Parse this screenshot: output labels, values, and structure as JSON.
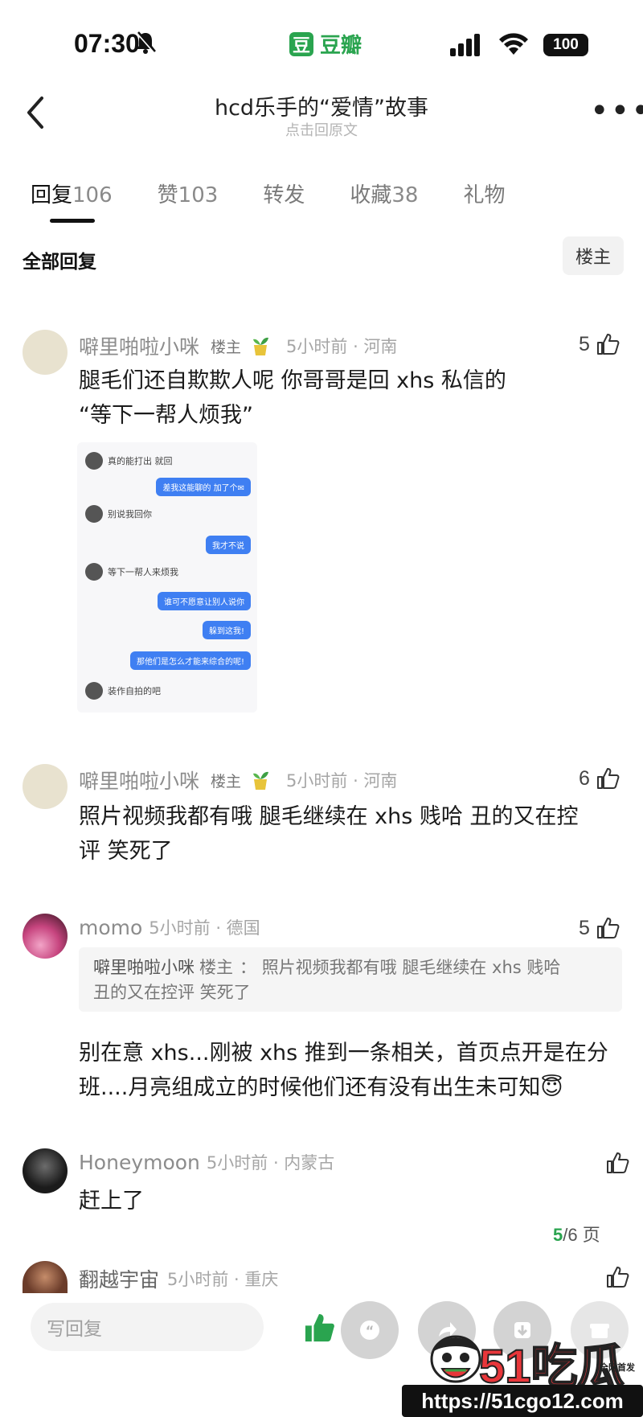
{
  "status_bar": {
    "time": "07:30",
    "app_name": "豆瓣",
    "app_logo_char": "豆",
    "battery": "100"
  },
  "header": {
    "title": "hcd乐手的“爱情”故事",
    "subtitle": "点击回原文"
  },
  "tabs": [
    {
      "label": "回复",
      "count": "106"
    },
    {
      "label": "赞",
      "count": "103"
    },
    {
      "label": "转发",
      "count": ""
    },
    {
      "label": "收藏",
      "count": "38"
    },
    {
      "label": "礼物",
      "count": ""
    }
  ],
  "section": {
    "all_replies": "全部回复",
    "op_filter": "楼主"
  },
  "comments": [
    {
      "name": "噼里啪啦小咪",
      "badge": "楼主",
      "meta": "5小时前 · 河南",
      "likes": "5",
      "lines": [
        "腿毛们还自欺欺人呢 你哥哥是回 xhs 私信的",
        "“等下一帮人烦我”"
      ],
      "image_chat": [
        "真的能打出 就回",
        "差我这能聊的 加了个✉",
        "别说我回你",
        "我才不说",
        "等下一帮人来烦我",
        "谁可不愿意让别人说你",
        "躲到这我!",
        "那他们是怎么才能来综合的呢!",
        "装作自拍的吧"
      ]
    },
    {
      "name": "噼里啪啦小咪",
      "badge": "楼主",
      "meta": "5小时前 · 河南",
      "likes": "6",
      "lines": [
        "照片视频我都有哦 腿毛继续在 xhs 贱哈  丑的又在控",
        "评 笑死了"
      ]
    },
    {
      "name": "momo",
      "badge": "",
      "meta": "5小时前 · 德国",
      "likes": "5",
      "quote": {
        "name": "噼里啪啦小咪",
        "badge": "楼主",
        "sep": "：",
        "text": "照片视频我都有哦 腿毛继续在 xhs 贱哈",
        "text2": "丑的又在控评 笑死了"
      },
      "lines": [
        "别在意 xhs...刚被 xhs 推到一条相关，首页点开是在分",
        "班....月亮组成立的时候他们还有没有出生未可知😇"
      ]
    },
    {
      "name": "Honeymoon",
      "badge": "",
      "meta": "5小时前 · 内蒙古",
      "likes": "",
      "lines": [
        "赶上了"
      ]
    },
    {
      "name": "翻越宇宙",
      "badge": "",
      "meta": "5小时前 · 重庆",
      "likes": "",
      "lines": []
    }
  ],
  "pagination": {
    "current": "5",
    "total_text": "/6 页"
  },
  "bottom_bar": {
    "reply_placeholder": "写回复"
  },
  "watermark": {
    "logo": "51吃瓜",
    "tagline": "全网首发",
    "url": "https://51cgo12.com"
  },
  "colors": {
    "brand_green": "#2aa44f",
    "text": "#1b1b1b",
    "muted": "#a6a6a6"
  }
}
